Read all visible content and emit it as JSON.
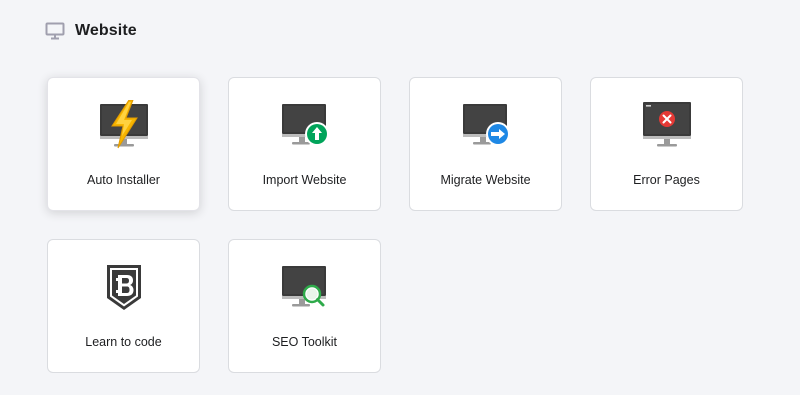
{
  "section": {
    "title": "Website",
    "icon": "monitor-icon"
  },
  "cards": [
    {
      "label": "Auto Installer",
      "icon": "auto-installer-icon"
    },
    {
      "label": "Import Website",
      "icon": "import-website-icon"
    },
    {
      "label": "Migrate Website",
      "icon": "migrate-website-icon"
    },
    {
      "label": "Error Pages",
      "icon": "error-pages-icon"
    },
    {
      "label": "Learn to code",
      "icon": "learn-to-code-icon"
    },
    {
      "label": "SEO Toolkit",
      "icon": "seo-toolkit-icon"
    }
  ],
  "colors": {
    "background": "#f4f5f8",
    "card": "#ffffff",
    "border": "#dadce0",
    "monitor_screen": "#36344d",
    "bolt": "#ffcd35",
    "import_green": "#00b090",
    "migrate_blue": "#357df9",
    "error_red": "#fc5185"
  }
}
